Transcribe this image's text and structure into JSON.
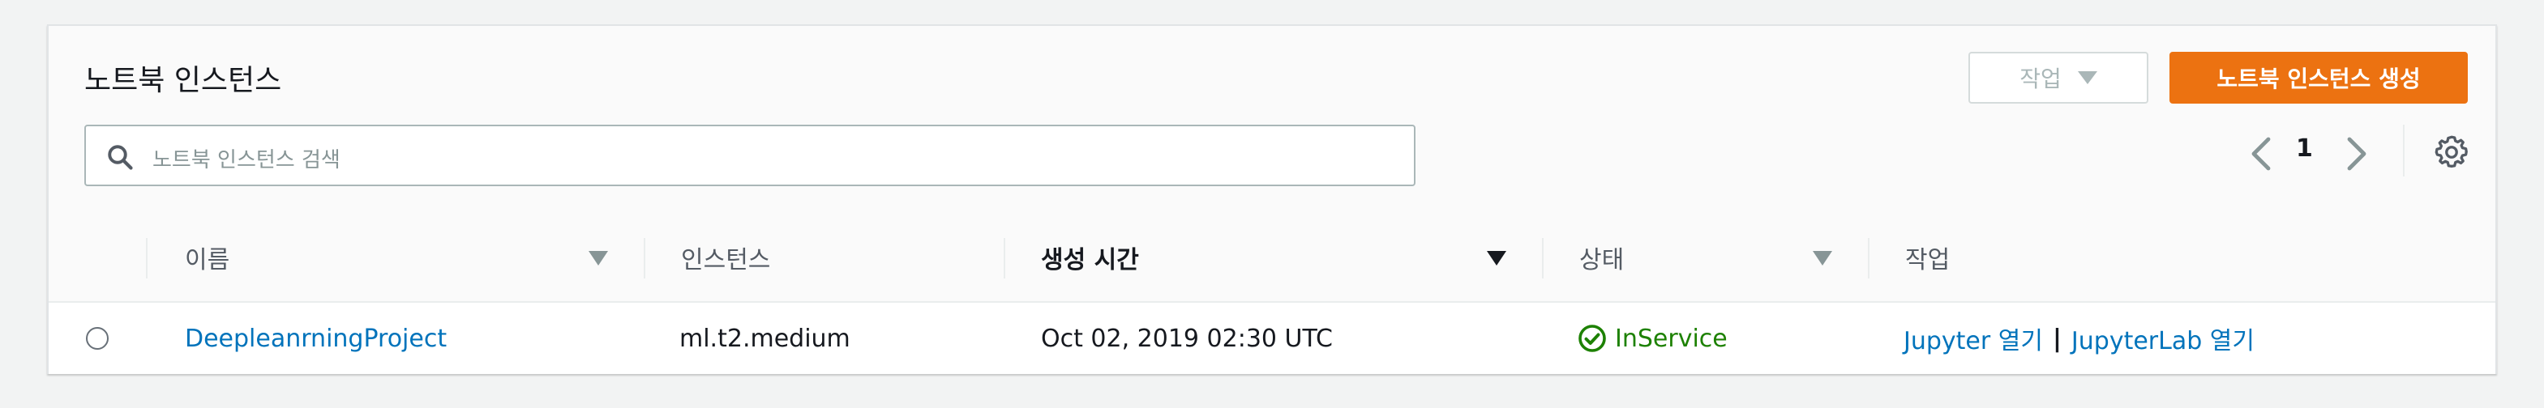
{
  "header": {
    "title": "노트북 인스턴스",
    "actions_label": "작업",
    "create_label": "노트북 인스턴스 생성"
  },
  "search": {
    "placeholder": "노트북 인스턴스 검색"
  },
  "pagination": {
    "current_page": "1"
  },
  "table": {
    "columns": [
      "이름",
      "인스턴스",
      "생성 시간",
      "상태",
      "작업"
    ],
    "sorted_column": "생성 시간",
    "rows": [
      {
        "name": "DeepleanrningProject",
        "instance": "ml.t2.medium",
        "created": "Oct 02, 2019 02:30 UTC",
        "status": "InService",
        "action_jupyter": "Jupyter 열기",
        "action_separator": "|",
        "action_jupyterlab": "JupyterLab 열기"
      }
    ]
  },
  "colors": {
    "accent": "#ec7211",
    "link": "#0073bb",
    "success": "#1d8102"
  },
  "icons": [
    "search-icon",
    "caret-down-icon",
    "chevron-left-icon",
    "chevron-right-icon",
    "gear-icon",
    "status-ok-icon"
  ]
}
